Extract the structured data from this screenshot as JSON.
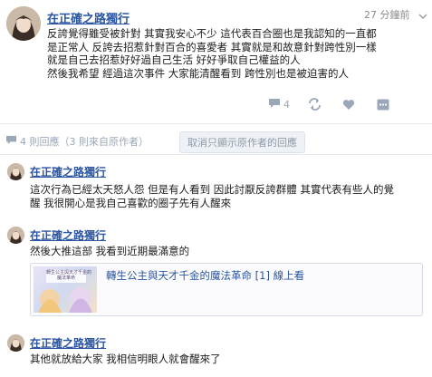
{
  "post": {
    "author": "在正確之路獨行",
    "time": "27 分鐘前",
    "lines": [
      "反誇覺得雖受被針對 其實我安心不少 這代表百合圈也是我認知的一直都",
      "是正常人 反誇去招惹針對百合的喜愛者 其實就是和故意針對跨性別一樣",
      "就是自己去招惹好好過自己生活 好好爭取自己權益的人",
      "然後我希望 經過這次事件 大家能清醒看到 跨性別也是被迫害的人"
    ],
    "comment_count": "4",
    "icons": {
      "comment": "comment-icon",
      "share": "share-icon",
      "like": "like-icon",
      "more": "more-icon",
      "dropdown": "chevron-down-icon"
    }
  },
  "replies_bar": {
    "count_text": "4 則回應（3 則來自原作者）",
    "filter_button": "取消只顯示原作者的回應"
  },
  "replies": [
    {
      "author": "在正確之路獨行",
      "lines": [
        "這次行為已經太天怒人怨 但是有人看到 因此討厭反誇群體 其實代表有些人的覺",
        "醒 我很開心是我自己喜歡的圈子先有人醒來"
      ]
    },
    {
      "author": "在正確之路獨行",
      "lines": [
        "然後大推這部 我看到近期最滿意的"
      ],
      "link": {
        "title": "轉生公主與天才千金的魔法革命 [1] 線上看",
        "thumb_caption": "轉生公主與天才千金的\n魔法革命"
      }
    },
    {
      "author": "在正確之路獨行",
      "lines": [
        "其他就放給大家 我相信明眼人就會醒來了"
      ]
    }
  ],
  "colors": {
    "link": "#2a55a2",
    "muted": "#9aa7b8"
  }
}
